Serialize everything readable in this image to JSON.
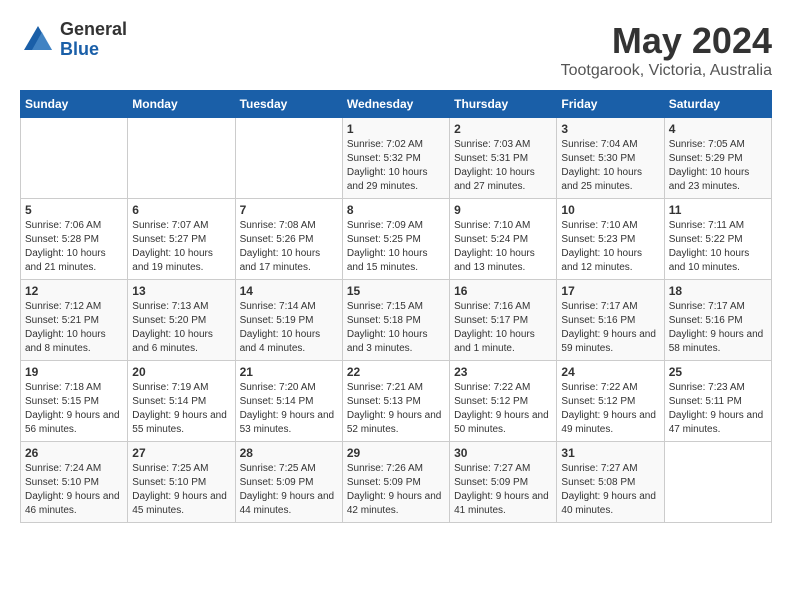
{
  "logo": {
    "general": "General",
    "blue": "Blue"
  },
  "title": "May 2024",
  "location": "Tootgarook, Victoria, Australia",
  "headers": [
    "Sunday",
    "Monday",
    "Tuesday",
    "Wednesday",
    "Thursday",
    "Friday",
    "Saturday"
  ],
  "weeks": [
    [
      {
        "day": "",
        "info": ""
      },
      {
        "day": "",
        "info": ""
      },
      {
        "day": "",
        "info": ""
      },
      {
        "day": "1",
        "info": "Sunrise: 7:02 AM\nSunset: 5:32 PM\nDaylight: 10 hours and 29 minutes."
      },
      {
        "day": "2",
        "info": "Sunrise: 7:03 AM\nSunset: 5:31 PM\nDaylight: 10 hours and 27 minutes."
      },
      {
        "day": "3",
        "info": "Sunrise: 7:04 AM\nSunset: 5:30 PM\nDaylight: 10 hours and 25 minutes."
      },
      {
        "day": "4",
        "info": "Sunrise: 7:05 AM\nSunset: 5:29 PM\nDaylight: 10 hours and 23 minutes."
      }
    ],
    [
      {
        "day": "5",
        "info": "Sunrise: 7:06 AM\nSunset: 5:28 PM\nDaylight: 10 hours and 21 minutes."
      },
      {
        "day": "6",
        "info": "Sunrise: 7:07 AM\nSunset: 5:27 PM\nDaylight: 10 hours and 19 minutes."
      },
      {
        "day": "7",
        "info": "Sunrise: 7:08 AM\nSunset: 5:26 PM\nDaylight: 10 hours and 17 minutes."
      },
      {
        "day": "8",
        "info": "Sunrise: 7:09 AM\nSunset: 5:25 PM\nDaylight: 10 hours and 15 minutes."
      },
      {
        "day": "9",
        "info": "Sunrise: 7:10 AM\nSunset: 5:24 PM\nDaylight: 10 hours and 13 minutes."
      },
      {
        "day": "10",
        "info": "Sunrise: 7:10 AM\nSunset: 5:23 PM\nDaylight: 10 hours and 12 minutes."
      },
      {
        "day": "11",
        "info": "Sunrise: 7:11 AM\nSunset: 5:22 PM\nDaylight: 10 hours and 10 minutes."
      }
    ],
    [
      {
        "day": "12",
        "info": "Sunrise: 7:12 AM\nSunset: 5:21 PM\nDaylight: 10 hours and 8 minutes."
      },
      {
        "day": "13",
        "info": "Sunrise: 7:13 AM\nSunset: 5:20 PM\nDaylight: 10 hours and 6 minutes."
      },
      {
        "day": "14",
        "info": "Sunrise: 7:14 AM\nSunset: 5:19 PM\nDaylight: 10 hours and 4 minutes."
      },
      {
        "day": "15",
        "info": "Sunrise: 7:15 AM\nSunset: 5:18 PM\nDaylight: 10 hours and 3 minutes."
      },
      {
        "day": "16",
        "info": "Sunrise: 7:16 AM\nSunset: 5:17 PM\nDaylight: 10 hours and 1 minute."
      },
      {
        "day": "17",
        "info": "Sunrise: 7:17 AM\nSunset: 5:16 PM\nDaylight: 9 hours and 59 minutes."
      },
      {
        "day": "18",
        "info": "Sunrise: 7:17 AM\nSunset: 5:16 PM\nDaylight: 9 hours and 58 minutes."
      }
    ],
    [
      {
        "day": "19",
        "info": "Sunrise: 7:18 AM\nSunset: 5:15 PM\nDaylight: 9 hours and 56 minutes."
      },
      {
        "day": "20",
        "info": "Sunrise: 7:19 AM\nSunset: 5:14 PM\nDaylight: 9 hours and 55 minutes."
      },
      {
        "day": "21",
        "info": "Sunrise: 7:20 AM\nSunset: 5:14 PM\nDaylight: 9 hours and 53 minutes."
      },
      {
        "day": "22",
        "info": "Sunrise: 7:21 AM\nSunset: 5:13 PM\nDaylight: 9 hours and 52 minutes."
      },
      {
        "day": "23",
        "info": "Sunrise: 7:22 AM\nSunset: 5:12 PM\nDaylight: 9 hours and 50 minutes."
      },
      {
        "day": "24",
        "info": "Sunrise: 7:22 AM\nSunset: 5:12 PM\nDaylight: 9 hours and 49 minutes."
      },
      {
        "day": "25",
        "info": "Sunrise: 7:23 AM\nSunset: 5:11 PM\nDaylight: 9 hours and 47 minutes."
      }
    ],
    [
      {
        "day": "26",
        "info": "Sunrise: 7:24 AM\nSunset: 5:10 PM\nDaylight: 9 hours and 46 minutes."
      },
      {
        "day": "27",
        "info": "Sunrise: 7:25 AM\nSunset: 5:10 PM\nDaylight: 9 hours and 45 minutes."
      },
      {
        "day": "28",
        "info": "Sunrise: 7:25 AM\nSunset: 5:09 PM\nDaylight: 9 hours and 44 minutes."
      },
      {
        "day": "29",
        "info": "Sunrise: 7:26 AM\nSunset: 5:09 PM\nDaylight: 9 hours and 42 minutes."
      },
      {
        "day": "30",
        "info": "Sunrise: 7:27 AM\nSunset: 5:09 PM\nDaylight: 9 hours and 41 minutes."
      },
      {
        "day": "31",
        "info": "Sunrise: 7:27 AM\nSunset: 5:08 PM\nDaylight: 9 hours and 40 minutes."
      },
      {
        "day": "",
        "info": ""
      }
    ]
  ]
}
